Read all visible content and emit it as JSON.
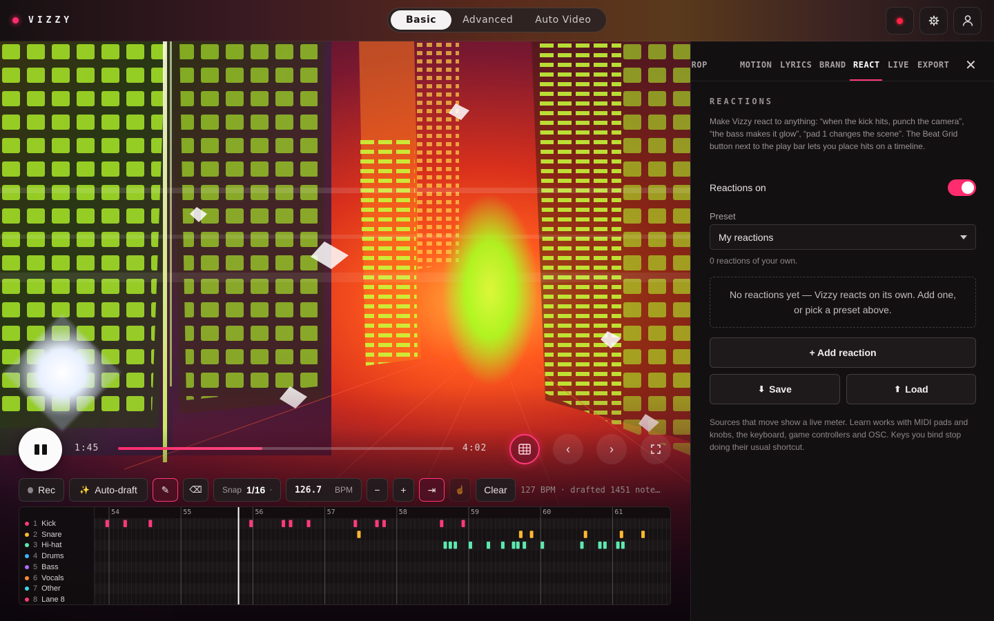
{
  "brand": {
    "name": "VIZZY",
    "dot_color": "#ff2d6f"
  },
  "mode_switch": {
    "options": [
      "Basic",
      "Advanced",
      "Auto Video"
    ],
    "selected": "Basic"
  },
  "top_icons": [
    "record-icon",
    "gear-icon",
    "user-icon"
  ],
  "accent_color": "#ff2d6f",
  "transport": {
    "current_time": "1:45",
    "total_time": "4:02",
    "progress": 0.43,
    "prev_glyph": "‹",
    "next_glyph": "›"
  },
  "toolbar": {
    "rec_label": "Rec",
    "autodraft_label": "Auto-draft",
    "autodraft_glyph": "✨",
    "pencil_glyph": "✎",
    "erase_glyph": "⌫",
    "snap_label": "Snap",
    "snap_value": "1/16",
    "bpm_value": "126.7",
    "bpm_unit": "BPM",
    "minus_glyph": "−",
    "plus_glyph": "+",
    "jump_glyph": "⇥",
    "tap_glyph": "☝",
    "clear_label": "Clear",
    "status": "127 BPM · drafted 1451 note…"
  },
  "beat_grid": {
    "bars": [
      "54",
      "55",
      "56",
      "57",
      "58",
      "59",
      "60",
      "61"
    ],
    "lanes": [
      {
        "num": "1",
        "name": "Kick",
        "color": "#ff3a78"
      },
      {
        "num": "2",
        "name": "Snare",
        "color": "#ffb830"
      },
      {
        "num": "3",
        "name": "Hi-hat",
        "color": "#5ee8b0"
      },
      {
        "num": "4",
        "name": "Drums",
        "color": "#3ab8ff"
      },
      {
        "num": "5",
        "name": "Bass",
        "color": "#b06cff"
      },
      {
        "num": "6",
        "name": "Vocals",
        "color": "#ff8a3a"
      },
      {
        "num": "7",
        "name": "Other",
        "color": "#40d8e8"
      },
      {
        "num": "8",
        "name": "Lane 8",
        "color": "#ff3a78"
      }
    ],
    "playhead_bar": 55.8,
    "notes": [
      {
        "lane": 0,
        "bars": [
          53.95,
          54.2,
          54.55,
          55.95,
          56.4,
          56.5,
          56.75,
          57.4,
          57.7,
          57.8,
          58.6,
          58.9
        ]
      },
      {
        "lane": 1,
        "bars": [
          57.45,
          59.7,
          59.85,
          60.6,
          61.1,
          61.4
        ]
      },
      {
        "lane": 2,
        "bars": [
          58.65,
          58.72,
          58.79,
          59.0,
          59.25,
          59.45,
          59.6,
          59.66,
          59.75,
          60.0,
          60.55,
          60.8,
          60.87,
          61.05,
          61.12
        ]
      }
    ]
  },
  "panel": {
    "tabs": [
      "BACKDROP",
      "MOTION",
      "LYRICS",
      "BRAND",
      "REACT",
      "LIVE",
      "EXPORT"
    ],
    "active_tab": "REACT",
    "section_title": "REACTIONS",
    "description": "Make Vizzy react to anything: “when the kick hits, punch the camera”, “the bass makes it glow”, “pad 1 changes the scene”. The Beat Grid button next to the play bar lets you place hits on a timeline.",
    "toggle_label": "Reactions on",
    "toggle_on": true,
    "preset_label": "Preset",
    "preset_value": "My reactions",
    "count_text": "0 reactions of your own.",
    "empty_text": "No reactions yet — Vizzy reacts on its own. Add one, or pick a preset above.",
    "add_label": "+ Add reaction",
    "save_label": "Save",
    "save_glyph": "⬇",
    "load_label": "Load",
    "load_glyph": "⬆",
    "footer": "Sources that move show a live meter. Learn works with MIDI pads and knobs, the keyboard, game controllers and OSC. Keys you bind stop doing their usual shortcut."
  }
}
